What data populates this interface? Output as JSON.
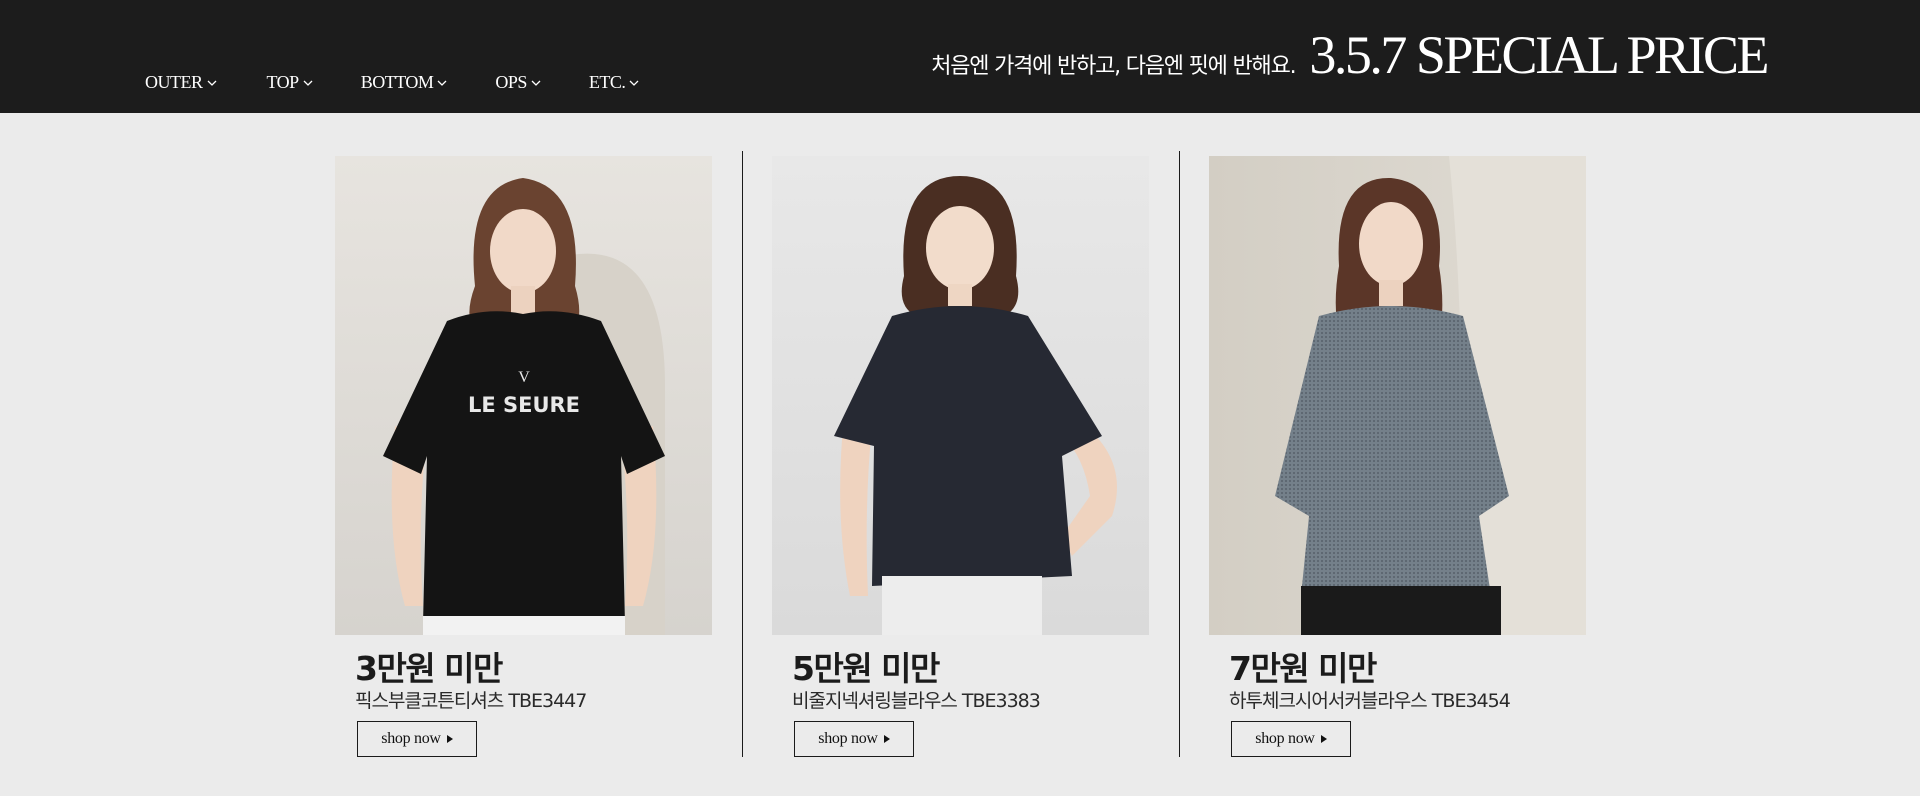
{
  "nav": {
    "items": [
      {
        "label": "OUTER"
      },
      {
        "label": "TOP"
      },
      {
        "label": "BOTTOM"
      },
      {
        "label": "OPS"
      },
      {
        "label": "ETC."
      }
    ]
  },
  "header": {
    "tagline": "처음엔 가격에 반하고, 다음엔 핏에 반해요.",
    "title": "3.5.7 SPECIAL PRICE"
  },
  "products": [
    {
      "price_label": "3만원 미만",
      "name": "픽스부클코튼티셔츠 TBE3447",
      "shop_label": "shop now",
      "print_text": "LE SEURE",
      "print_mark": "V",
      "colors": {
        "bg_top": "#e4e1dc",
        "bg_bottom": "#d3d0cb",
        "garment": "#141414"
      }
    },
    {
      "price_label": "5만원 미만",
      "name": "비줄지넥셔링블라우스 TBE3383",
      "shop_label": "shop now",
      "colors": {
        "bg_top": "#e6e6e6",
        "bg_bottom": "#d8d8d8",
        "garment": "#262933"
      }
    },
    {
      "price_label": "7만원 미만",
      "name": "하투체크시어서커블라우스 TBE3454",
      "shop_label": "shop now",
      "colors": {
        "bg_top": "#d9d5cc",
        "bg_bottom": "#cbc6bb",
        "garment": "#6f7a84"
      }
    }
  ],
  "colors": {
    "topbar": "#1c1c1c",
    "page_bg": "#ebebeb",
    "text": "#1b1b1b"
  }
}
